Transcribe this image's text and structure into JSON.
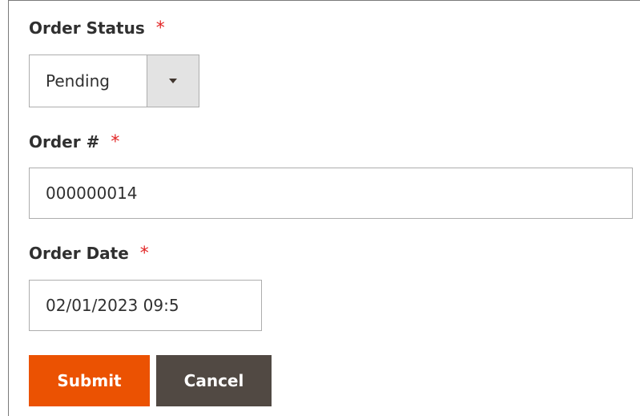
{
  "form": {
    "order_status": {
      "label": "Order Status",
      "required_marker": "*",
      "selected_value": "Pending"
    },
    "order_number": {
      "label": "Order #",
      "required_marker": "*",
      "value": "000000014"
    },
    "order_date": {
      "label": "Order Date",
      "required_marker": "*",
      "value": "02/01/2023 09:5"
    }
  },
  "actions": {
    "submit_label": "Submit",
    "cancel_label": "Cancel"
  },
  "colors": {
    "required": "#e22626",
    "submit_bg": "#eb5202",
    "cancel_bg": "#514943",
    "select_toggle_bg": "#e3e3e3"
  },
  "icons": {
    "select_toggle": "chevron-down-icon"
  }
}
